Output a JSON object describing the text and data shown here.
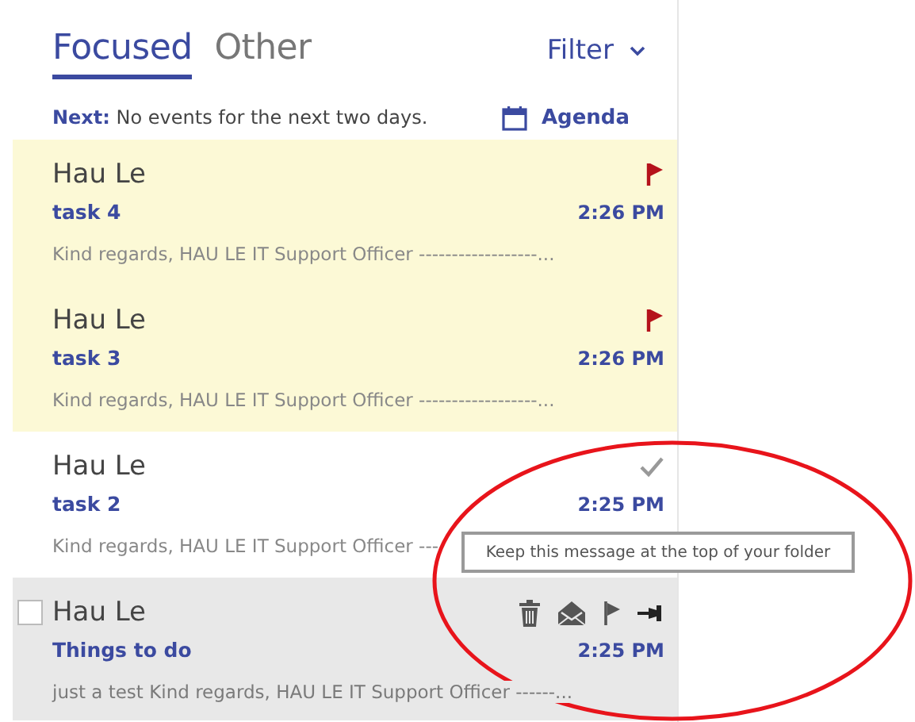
{
  "tabs": [
    {
      "label": "Focused",
      "selected": true
    },
    {
      "label": "Other",
      "selected": false
    }
  ],
  "filter": {
    "label": "Filter"
  },
  "next_bar": {
    "label": "Next:",
    "text": "No events for the next two days.",
    "agenda": "Agenda"
  },
  "messages": [
    {
      "sender": "Hau Le",
      "subject": "task 4",
      "time": "2:26 PM",
      "preview": "Kind regards, HAU LE IT Support Officer ------------------...",
      "pinned": true,
      "flagged": true,
      "completed": false,
      "hovered": false
    },
    {
      "sender": "Hau Le",
      "subject": "task 3",
      "time": "2:26 PM",
      "preview": "Kind regards, HAU LE IT Support Officer ------------------...",
      "pinned": true,
      "flagged": true,
      "completed": false,
      "hovered": false
    },
    {
      "sender": "Hau Le",
      "subject": "task 2",
      "time": "2:25 PM",
      "preview": "Kind regards, HAU LE IT Support Officer ---",
      "pinned": false,
      "flagged": false,
      "completed": true,
      "hovered": false
    },
    {
      "sender": "Hau Le",
      "subject": "Things to do",
      "time": "2:25 PM",
      "preview": "just a test Kind regards, HAU LE IT Support Officer ------...",
      "pinned": false,
      "flagged": false,
      "completed": false,
      "hovered": true,
      "checked": false
    }
  ],
  "tooltip": {
    "text": "Keep this message at the top of your folder"
  },
  "annotation": {
    "kind": "ellipse",
    "color": "#e8141b"
  }
}
